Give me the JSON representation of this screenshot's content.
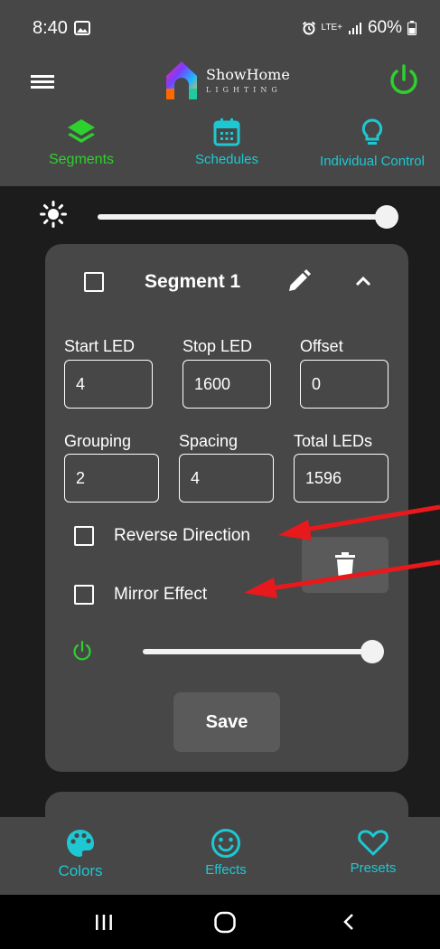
{
  "status": {
    "time": "8:40",
    "network": "LTE+",
    "battery": "60%"
  },
  "app": {
    "brand": "ShowHome",
    "brand_sub": "LIGHTING"
  },
  "tabs": [
    {
      "label": "Segments",
      "icon": "layers-icon",
      "active": true
    },
    {
      "label": "Schedules",
      "icon": "calendar-icon",
      "active": false
    },
    {
      "label": "Individual Control",
      "icon": "lightbulb-icon",
      "active": false
    }
  ],
  "brightness": {
    "level": 1.0
  },
  "segment": {
    "title": "Segment 1",
    "fields": {
      "start_led": {
        "label": "Start LED",
        "value": "4"
      },
      "stop_led": {
        "label": "Stop LED",
        "value": "1600"
      },
      "offset": {
        "label": "Offset",
        "value": "0"
      },
      "grouping": {
        "label": "Grouping",
        "value": "2"
      },
      "spacing": {
        "label": "Spacing",
        "value": "4"
      },
      "total_leds": {
        "label": "Total LEDs",
        "value": "1596"
      }
    },
    "reverse_label": "Reverse Direction",
    "mirror_label": "Mirror Effect",
    "segment_brightness": {
      "level": 1.0
    },
    "save_label": "Save"
  },
  "bottom_nav": [
    {
      "label": "Colors",
      "icon": "palette-icon",
      "active": true
    },
    {
      "label": "Effects",
      "icon": "smiley-icon",
      "active": false
    },
    {
      "label": "Presets",
      "icon": "heart-icon",
      "active": false
    }
  ],
  "colors": {
    "accent_cyan": "#1ec8d2",
    "accent_green": "#2ed02e",
    "annotation_red": "#e8191c",
    "panel": "#474747",
    "background": "#1c1c1c"
  }
}
